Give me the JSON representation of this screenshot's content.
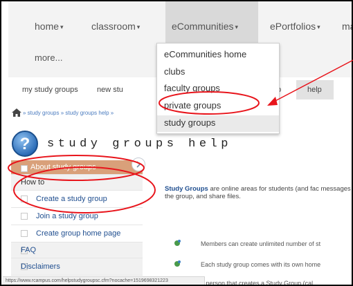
{
  "topnav": {
    "items": [
      {
        "label": "home",
        "caret": "▾"
      },
      {
        "label": "classroom",
        "caret": "▾"
      },
      {
        "label": "eCommunities",
        "caret": "▾"
      },
      {
        "label": "ePortfolios",
        "caret": "▾"
      },
      {
        "label": "ma"
      }
    ],
    "more_label": "more..."
  },
  "dropdown": {
    "items": [
      "eCommunities home",
      "clubs",
      "faculty groups",
      "private groups",
      "study groups"
    ]
  },
  "subnav": {
    "items": [
      "my study groups",
      "new stu",
      "p",
      "help"
    ]
  },
  "breadcrumb": "» study groups » study groups help »",
  "page_title": "study groups help",
  "sidebar": {
    "items": [
      {
        "label": "About study groups",
        "kind": "active"
      },
      {
        "label": "How to",
        "kind": "section"
      },
      {
        "label": "Create a study group",
        "kind": "sub"
      },
      {
        "label": "Join a study group",
        "kind": "sub"
      },
      {
        "label": "Create group home page",
        "kind": "sub"
      },
      {
        "label": "FAQ",
        "kind": "section"
      },
      {
        "label": "Disclaimers",
        "kind": "section"
      }
    ]
  },
  "content": {
    "intro_bold": "Study Groups",
    "intro_rest": " are online areas for students (and fac messages to the group, and share files.",
    "bullets": [
      "Members can create unlimited number of st",
      "Each study group comes with its own home",
      "e person that creates a Study Group (cal"
    ]
  },
  "status_url": "https://www.rcampus.com/helpstudygroupsc.cfm?nocache=1519698321223",
  "colors": {
    "annotation_red": "#e8141b",
    "active_item": "#d9a07a",
    "link_blue": "#1f4e8f"
  }
}
